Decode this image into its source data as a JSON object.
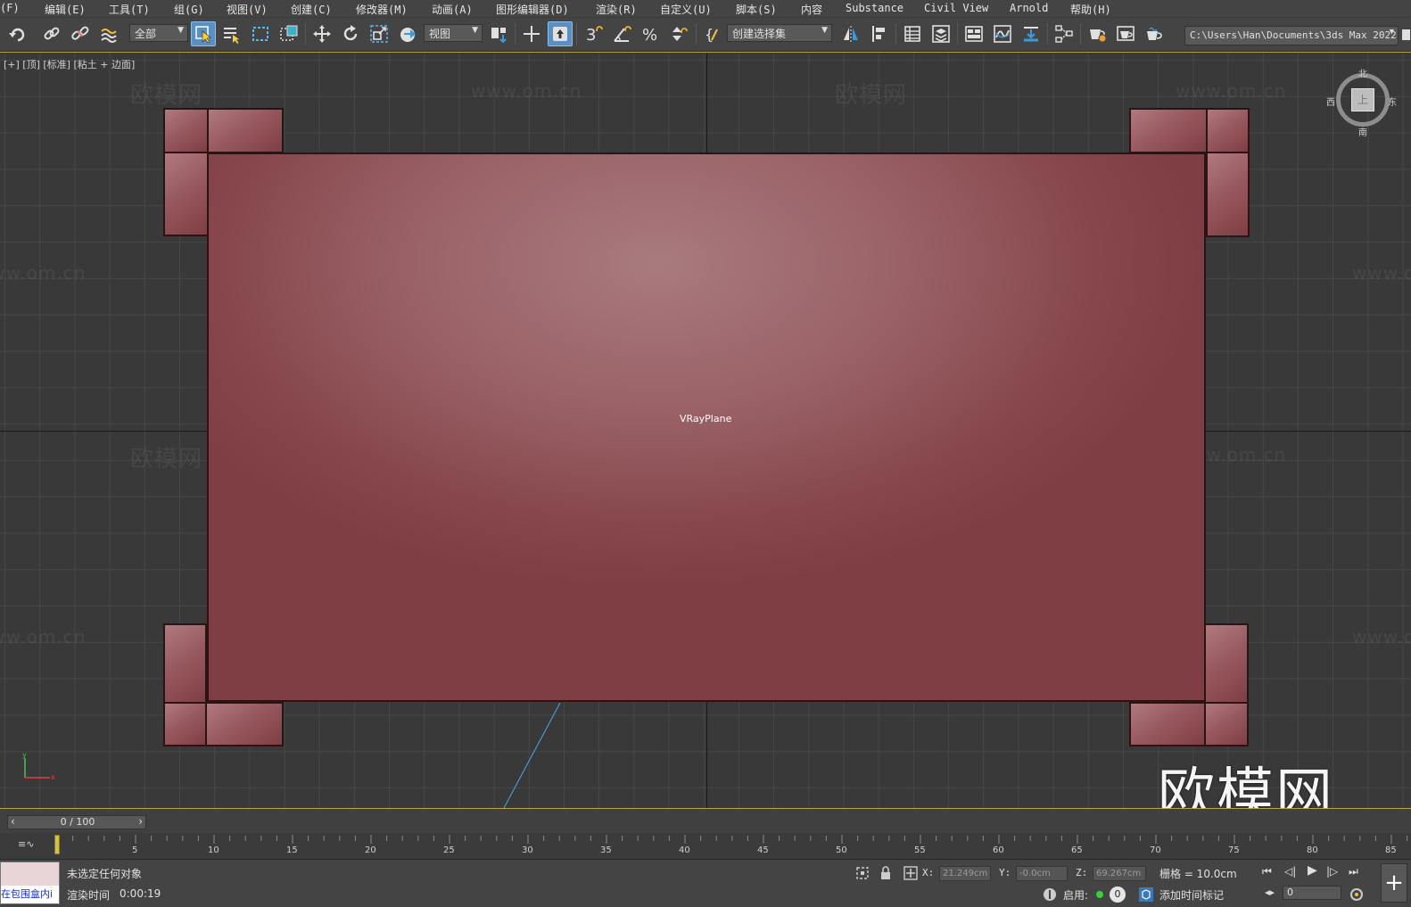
{
  "menu": {
    "items": [
      "(F)",
      "编辑(E)",
      "工具(T)",
      "组(G)",
      "视图(V)",
      "创建(C)",
      "修改器(M)",
      "动画(A)",
      "图形编辑器(D)",
      "渲染(R)",
      "自定义(U)",
      "脚本(S)",
      "内容",
      "Substance",
      "Civil View",
      "Arnold",
      "帮助(H)"
    ]
  },
  "toolbar": {
    "selection_filter": "全部",
    "reference_coord": "视图",
    "named_selection": "创建选择集",
    "path": "C:\\Users\\Han\\Documents\\3ds Max 2022",
    "snap_label": "3",
    "icons": [
      "undo-icon",
      "link-icon",
      "unlink-icon",
      "bind-spacewarp-icon",
      "select-object-icon",
      "select-by-name-icon",
      "rect-selection-icon",
      "window-crossing-icon",
      "move-icon",
      "rotate-icon",
      "scale-icon",
      "placement-icon",
      "pivot-icon",
      "snap-toggle-icon",
      "angle-snap-icon",
      "percent-snap-icon",
      "spinner-snap-icon",
      "edit-named-sets-icon",
      "mirror-icon",
      "align-icon",
      "scene-explorer-icon",
      "layer-explorer-icon",
      "toggle-ribbon-icon",
      "curve-editor-icon",
      "dope-sheet-icon",
      "schematic-view-icon",
      "render-setup-icon",
      "rendered-frame-icon",
      "render-icon"
    ]
  },
  "viewport": {
    "label": "[+] [顶] [标准] [粘土 + 边面]",
    "object_name": "VRayPlane",
    "watermark_text": "欧模网",
    "watermark_url": "www.om.cn",
    "logo_text": "欧模网",
    "compass": {
      "n": "北",
      "s": "南",
      "e": "东",
      "w": "西"
    },
    "cube_face": "上",
    "axis_y": "y",
    "axis_x": "x"
  },
  "timeline": {
    "time_value": "0 / 100",
    "ticks": [
      "5",
      "10",
      "15",
      "20",
      "25",
      "30",
      "35",
      "40",
      "45",
      "50",
      "55",
      "60",
      "65",
      "70",
      "75",
      "80",
      "85"
    ]
  },
  "status": {
    "mini_listener_text": "在包围盒内i",
    "selection_status": "未选定任何对象",
    "render_time_label": "渲染时间",
    "render_time_value": "0:00:19",
    "x_label": "X:",
    "x_value": "21.249cm",
    "y_label": "Y:",
    "y_value": "-0.0cm",
    "z_label": "Z:",
    "z_value": "69.267cm",
    "grid_label": "栅格 = 10.0cm",
    "enable_label": "启用:",
    "enable_value": "0",
    "add_time_tag": "添加时间标记",
    "frame_value": "0"
  },
  "colors": {
    "accent": "#5a8fc2",
    "timeline_border": "#b7a54a",
    "object_fill": "#9a6267"
  }
}
